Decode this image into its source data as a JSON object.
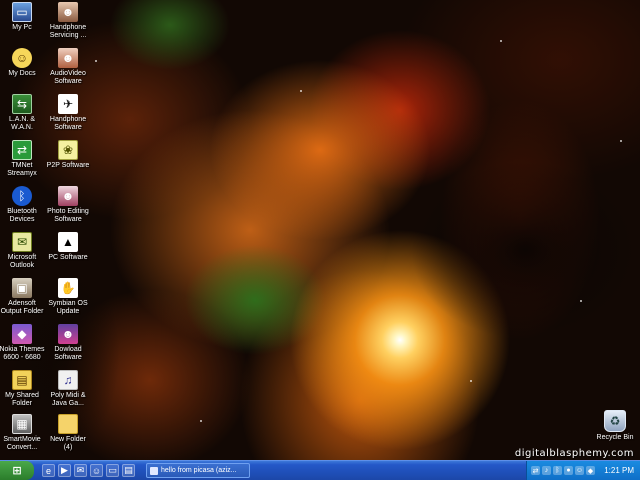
{
  "desktop": {
    "watermark": "digitalblasphemy.com",
    "icons_left": [
      {
        "label": "My Pc",
        "name": "my-pc-icon"
      },
      {
        "label": "My Docs",
        "name": "my-docs-icon"
      },
      {
        "label": "L.A.N. &\nW.A.N.",
        "name": "lan-wan-icon"
      },
      {
        "label": "TMNet\nStreamyx",
        "name": "tmnet-streamyx-icon"
      },
      {
        "label": "Bluetooth\nDevices",
        "name": "bluetooth-devices-icon"
      },
      {
        "label": "Microsoft\nOutlook",
        "name": "microsoft-outlook-icon"
      },
      {
        "label": "Adensoft\nOutput Folder",
        "name": "adensoft-output-folder-icon"
      },
      {
        "label": "Nokia Themes\n6600 - 6680",
        "name": "nokia-themes-icon"
      },
      {
        "label": "My Shared\nFolder",
        "name": "my-shared-folder-icon"
      },
      {
        "label": "SmartMovie\nConvert...",
        "name": "smartmovie-convert-icon"
      }
    ],
    "icons_right": [
      {
        "label": "Handphone\nServicing ...",
        "name": "handphone-servicing-icon"
      },
      {
        "label": "AudioVideo\nSoftware",
        "name": "audiovideo-software-icon"
      },
      {
        "label": "Handphone\nSoftware",
        "name": "handphone-software-icon"
      },
      {
        "label": "P2P Software",
        "name": "p2p-software-icon"
      },
      {
        "label": "Photo Editing\nSoftware",
        "name": "photo-editing-software-icon"
      },
      {
        "label": "PC Software",
        "name": "pc-software-icon"
      },
      {
        "label": "Symbian OS\nUpdate",
        "name": "symbian-os-update-icon"
      },
      {
        "label": "Dowload\nSoftware",
        "name": "dowload-software-icon"
      },
      {
        "label": "Poly Midi &\nJava Ga...",
        "name": "poly-midi-java-icon"
      },
      {
        "label": "New Folder\n(4)",
        "name": "new-folder-4-icon"
      }
    ],
    "recycle_bin": {
      "label": "Recycle Bin",
      "name": "recycle-bin-icon"
    }
  },
  "taskbar": {
    "start_label": "start",
    "task_label": "hello from picasa (aziz...",
    "clock": "1:21 PM",
    "quick_launch": [
      "ie-icon",
      "media-player-icon",
      "outlook-icon",
      "messenger-icon",
      "desktop-icon",
      "explorer-icon"
    ],
    "tray": [
      "network-icon",
      "volume-icon",
      "bluetooth-icon",
      "antivirus-icon",
      "messenger-icon",
      "security-icon"
    ]
  }
}
